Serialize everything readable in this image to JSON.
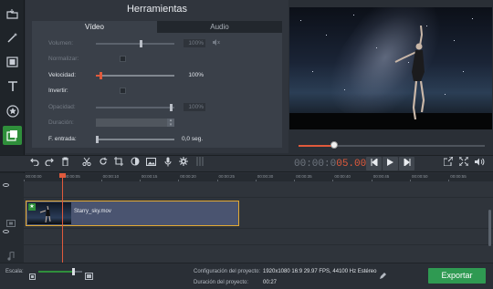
{
  "panel": {
    "title": "Herramientas",
    "tabs": [
      {
        "label": "Vídeo",
        "active": true
      },
      {
        "label": "Audio",
        "active": false
      }
    ],
    "properties": {
      "volume": {
        "label": "Volumen:",
        "value": "100%",
        "level": 0.58
      },
      "normalize": {
        "label": "Normalizar:"
      },
      "speed": {
        "label": "Velocidad:",
        "value": "100%",
        "level": 0.05
      },
      "invert": {
        "label": "Invertir:"
      },
      "opacity": {
        "label": "Opacidad:",
        "value": "100%",
        "level": 0.98
      },
      "duration": {
        "label": "Duración:"
      },
      "fade_in": {
        "label": "F. entrada:",
        "value": "0,0 seg.",
        "level": 0.0
      }
    }
  },
  "preview": {
    "progress": 0.19
  },
  "toolbar": {
    "time_grey": "00:00:0",
    "time_red": "05.000"
  },
  "ruler": {
    "ticks": [
      "00:00:00",
      "00:00:05",
      "00:00:10",
      "00:00:15",
      "00:00:20",
      "00:00:25",
      "00:00:30",
      "00:00:35",
      "00:00:40",
      "00:00:45",
      "00:00:50",
      "00:00:55"
    ]
  },
  "clip": {
    "name": "Starry_sky.mov"
  },
  "status": {
    "scale_label": "Escala:",
    "scale_level": 0.83,
    "config_label": "Configuración del proyecto:",
    "config_value": "1920x1080 16:9 29.97 FPS, 44100 Hz Estéreo",
    "duration_label": "Duración del proyecto:",
    "duration_value": "00:27",
    "export_label": "Exportar"
  },
  "colors": {
    "accent_red": "#e05a3c",
    "accent_green": "#2f9a52",
    "clip_border": "#e2a934"
  },
  "icons": [
    "magic-wand-icon",
    "film-strip-icon",
    "text-icon",
    "star-icon",
    "filters-icon",
    "menu-icon",
    "undo-icon",
    "redo-icon",
    "trash-icon",
    "scissors-icon",
    "rotate-icon",
    "crop-icon",
    "color-icon",
    "image-icon",
    "mic-icon",
    "settings-icon",
    "equalizer-icon",
    "skip-back-icon",
    "play-icon",
    "skip-forward-icon",
    "export-icon",
    "fullscreen-icon",
    "volume-icon",
    "pencil-icon"
  ]
}
